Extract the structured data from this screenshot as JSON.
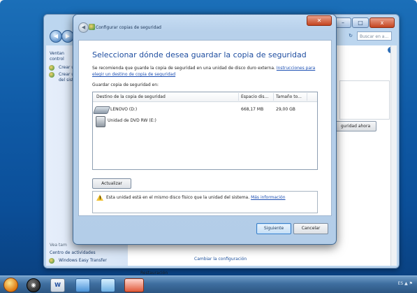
{
  "background_window": {
    "search_placeholder": "Buscar en a...",
    "help_icon": "help-icon",
    "left_panel": {
      "items": [
        "Ventan",
        "control",
        "Crear u",
        "Crear u",
        "del siste"
      ],
      "see_also": "Vea tam",
      "action_center": "Centro de actividades",
      "easy_transfer": "Windows Easy Transfer"
    },
    "backup_now_label": "Hacer una copia de seguridad ahora",
    "backup_now_visible": "guridad ahora",
    "change_settings_label": "Cambiar la configuración",
    "restore_label": "Restauración"
  },
  "dialog": {
    "title": "Configurar copias de seguridad",
    "heading": "Seleccionar dónde desea guardar la copia de seguridad",
    "description": "Se recomienda que guarde la copia de seguridad en una unidad de disco duro externa.",
    "instructions_link": "Instrucciones para elegir un destino de copia de seguridad",
    "save_to_label": "Guardar copia de seguridad en:",
    "columns": {
      "destination": "Destino de la copia de seguridad",
      "free_space": "Espacio dis...",
      "total_size": "Tamaño to..."
    },
    "destinations": [
      {
        "name": "LENOVO (D:)",
        "free_space": "668,17 MB",
        "total_size": "29,00 GB",
        "icon": "hard-drive-icon"
      },
      {
        "name": "Unidad de DVD RW (E:)",
        "free_space": "",
        "total_size": "",
        "icon": "dvd-drive-icon"
      }
    ],
    "refresh_button": "Actualizar",
    "warning_text": "Esta unidad está en el mismo disco físico que la unidad del sistema.",
    "more_info_link": "Más información",
    "next_button": "Siguiente",
    "cancel_button": "Cancelar",
    "close_glyph": "✕",
    "back_glyph": "◀"
  },
  "taskbar": {
    "apps": [
      "start-orb",
      "app-dark-circle",
      "word-icon",
      "network-icon",
      "paint-icon",
      "photo-icon"
    ],
    "tray_text": "ES ▲ ⚑"
  }
}
